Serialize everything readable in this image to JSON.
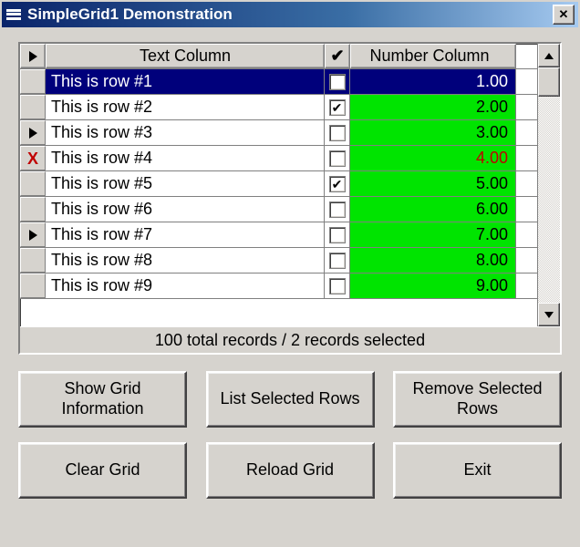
{
  "window": {
    "title": "SimpleGrid1 Demonstration"
  },
  "grid": {
    "columns": {
      "text_header": "Text Column",
      "check_header": "✔",
      "number_header": "Number Column"
    },
    "rows": [
      {
        "marker": "",
        "text": "This is row #1",
        "checked": false,
        "number": "1.00",
        "selected": true,
        "num_red": false
      },
      {
        "marker": "",
        "text": "This is row #2",
        "checked": true,
        "number": "2.00",
        "selected": false,
        "num_red": false
      },
      {
        "marker": "arrow",
        "text": "This is row #3",
        "checked": false,
        "number": "3.00",
        "selected": false,
        "num_red": false
      },
      {
        "marker": "x",
        "text": "This is row #4",
        "checked": false,
        "number": "4.00",
        "selected": false,
        "num_red": true
      },
      {
        "marker": "",
        "text": "This is row #5",
        "checked": true,
        "number": "5.00",
        "selected": false,
        "num_red": false
      },
      {
        "marker": "",
        "text": "This is row #6",
        "checked": false,
        "number": "6.00",
        "selected": false,
        "num_red": false
      },
      {
        "marker": "arrow",
        "text": "This is row #7",
        "checked": false,
        "number": "7.00",
        "selected": false,
        "num_red": false
      },
      {
        "marker": "",
        "text": "This is row #8",
        "checked": false,
        "number": "8.00",
        "selected": false,
        "num_red": false
      },
      {
        "marker": "",
        "text": "This is row #9",
        "checked": false,
        "number": "9.00",
        "selected": false,
        "num_red": false
      }
    ],
    "status": "100 total records / 2 records selected"
  },
  "buttons": {
    "show_info": "Show Grid Information",
    "list_selected": "List Selected Rows",
    "remove_selected": "Remove Selected Rows",
    "clear": "Clear Grid",
    "reload": "Reload Grid",
    "exit": "Exit"
  },
  "icons": {
    "close": "✕",
    "checkmark_header": "✔",
    "checkmark": "✔",
    "header_arrow": "▶"
  }
}
